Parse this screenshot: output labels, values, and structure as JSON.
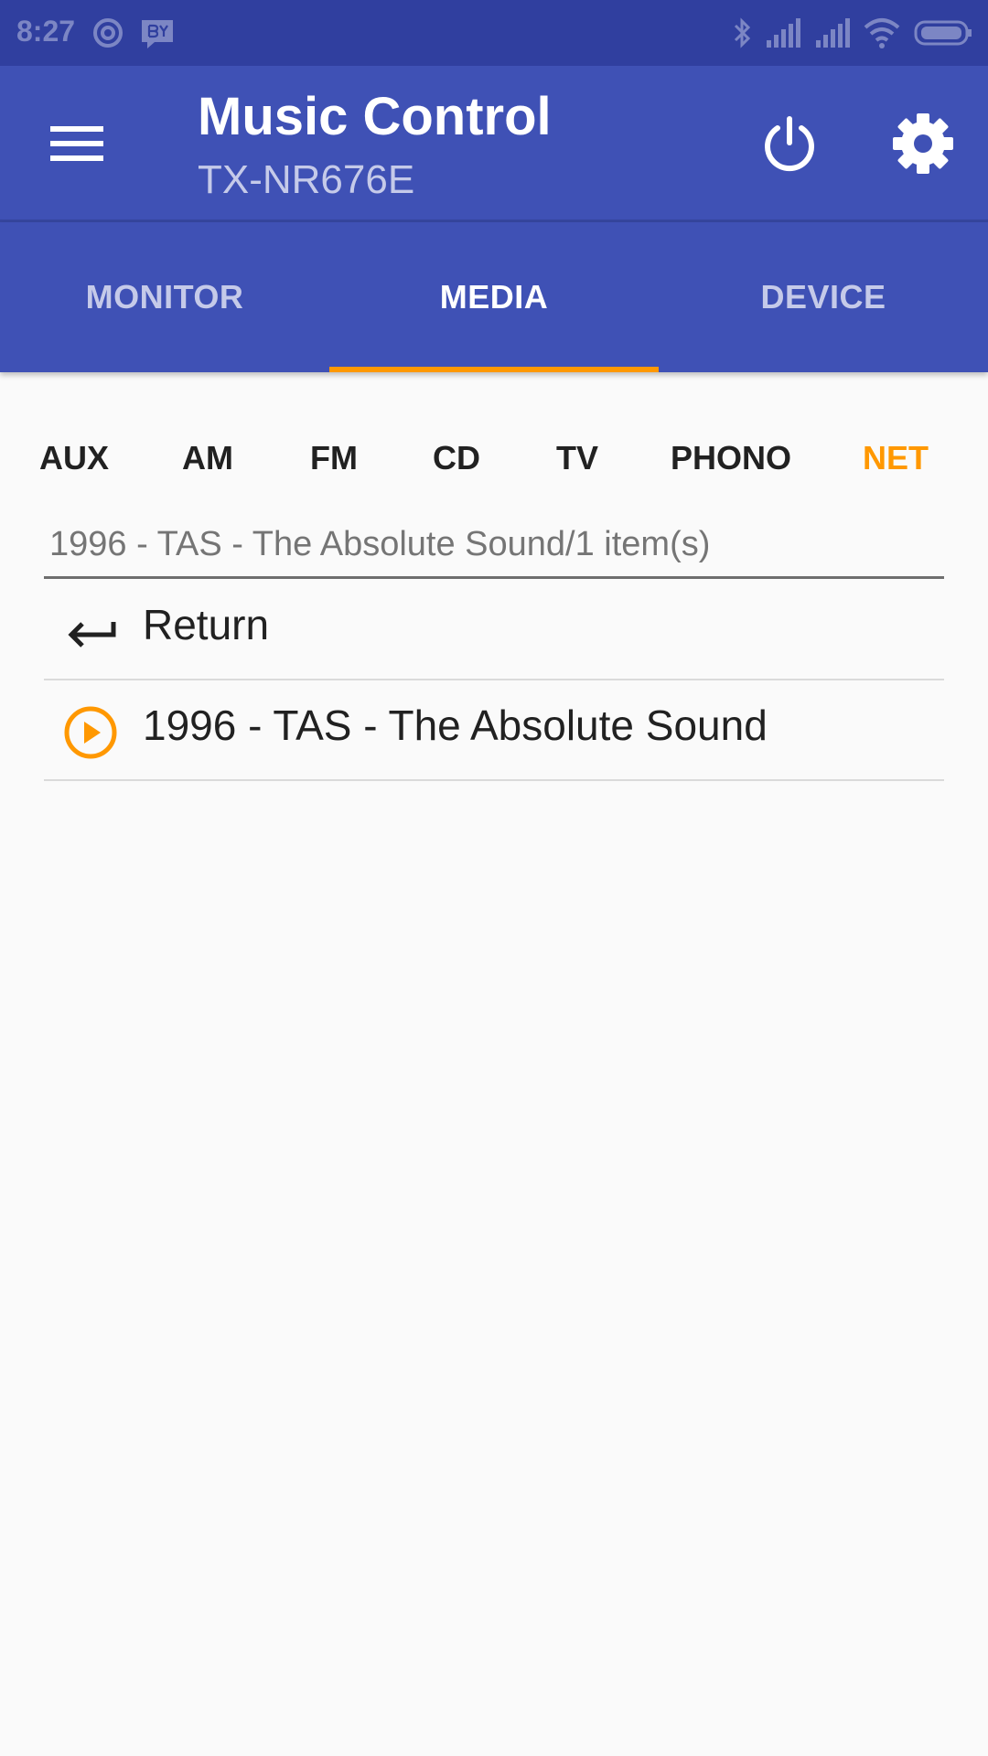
{
  "status_bar": {
    "time": "8:27",
    "icons": [
      "at-sign-icon",
      "by-badge-icon",
      "bluetooth-icon",
      "signal-icon",
      "signal-icon",
      "wifi-icon",
      "battery-icon"
    ]
  },
  "app_bar": {
    "title": "Music Control",
    "subtitle": "TX-NR676E",
    "icons": [
      "menu-icon",
      "power-icon",
      "gear-icon"
    ]
  },
  "tabs": [
    {
      "label": "MONITOR",
      "active": false
    },
    {
      "label": "MEDIA",
      "active": true
    },
    {
      "label": "DEVICE",
      "active": false
    }
  ],
  "inputs": [
    {
      "label": "AUX",
      "active": false
    },
    {
      "label": "AM",
      "active": false
    },
    {
      "label": "FM",
      "active": false
    },
    {
      "label": "CD",
      "active": false
    },
    {
      "label": "TV",
      "active": false
    },
    {
      "label": "PHONO",
      "active": false
    },
    {
      "label": "NET",
      "active": true
    }
  ],
  "path": "1996 - TAS - The Absolute Sound/1 item(s)",
  "list": [
    {
      "label": "Return",
      "icon": "return-arrow-icon"
    },
    {
      "label": "1996 - TAS - The Absolute Sound",
      "icon": "play-circle-icon"
    }
  ],
  "colors": {
    "primary": "#3f51b5",
    "primary_dark": "#303f9f",
    "accent": "#ff9800",
    "background": "#fafafa"
  }
}
